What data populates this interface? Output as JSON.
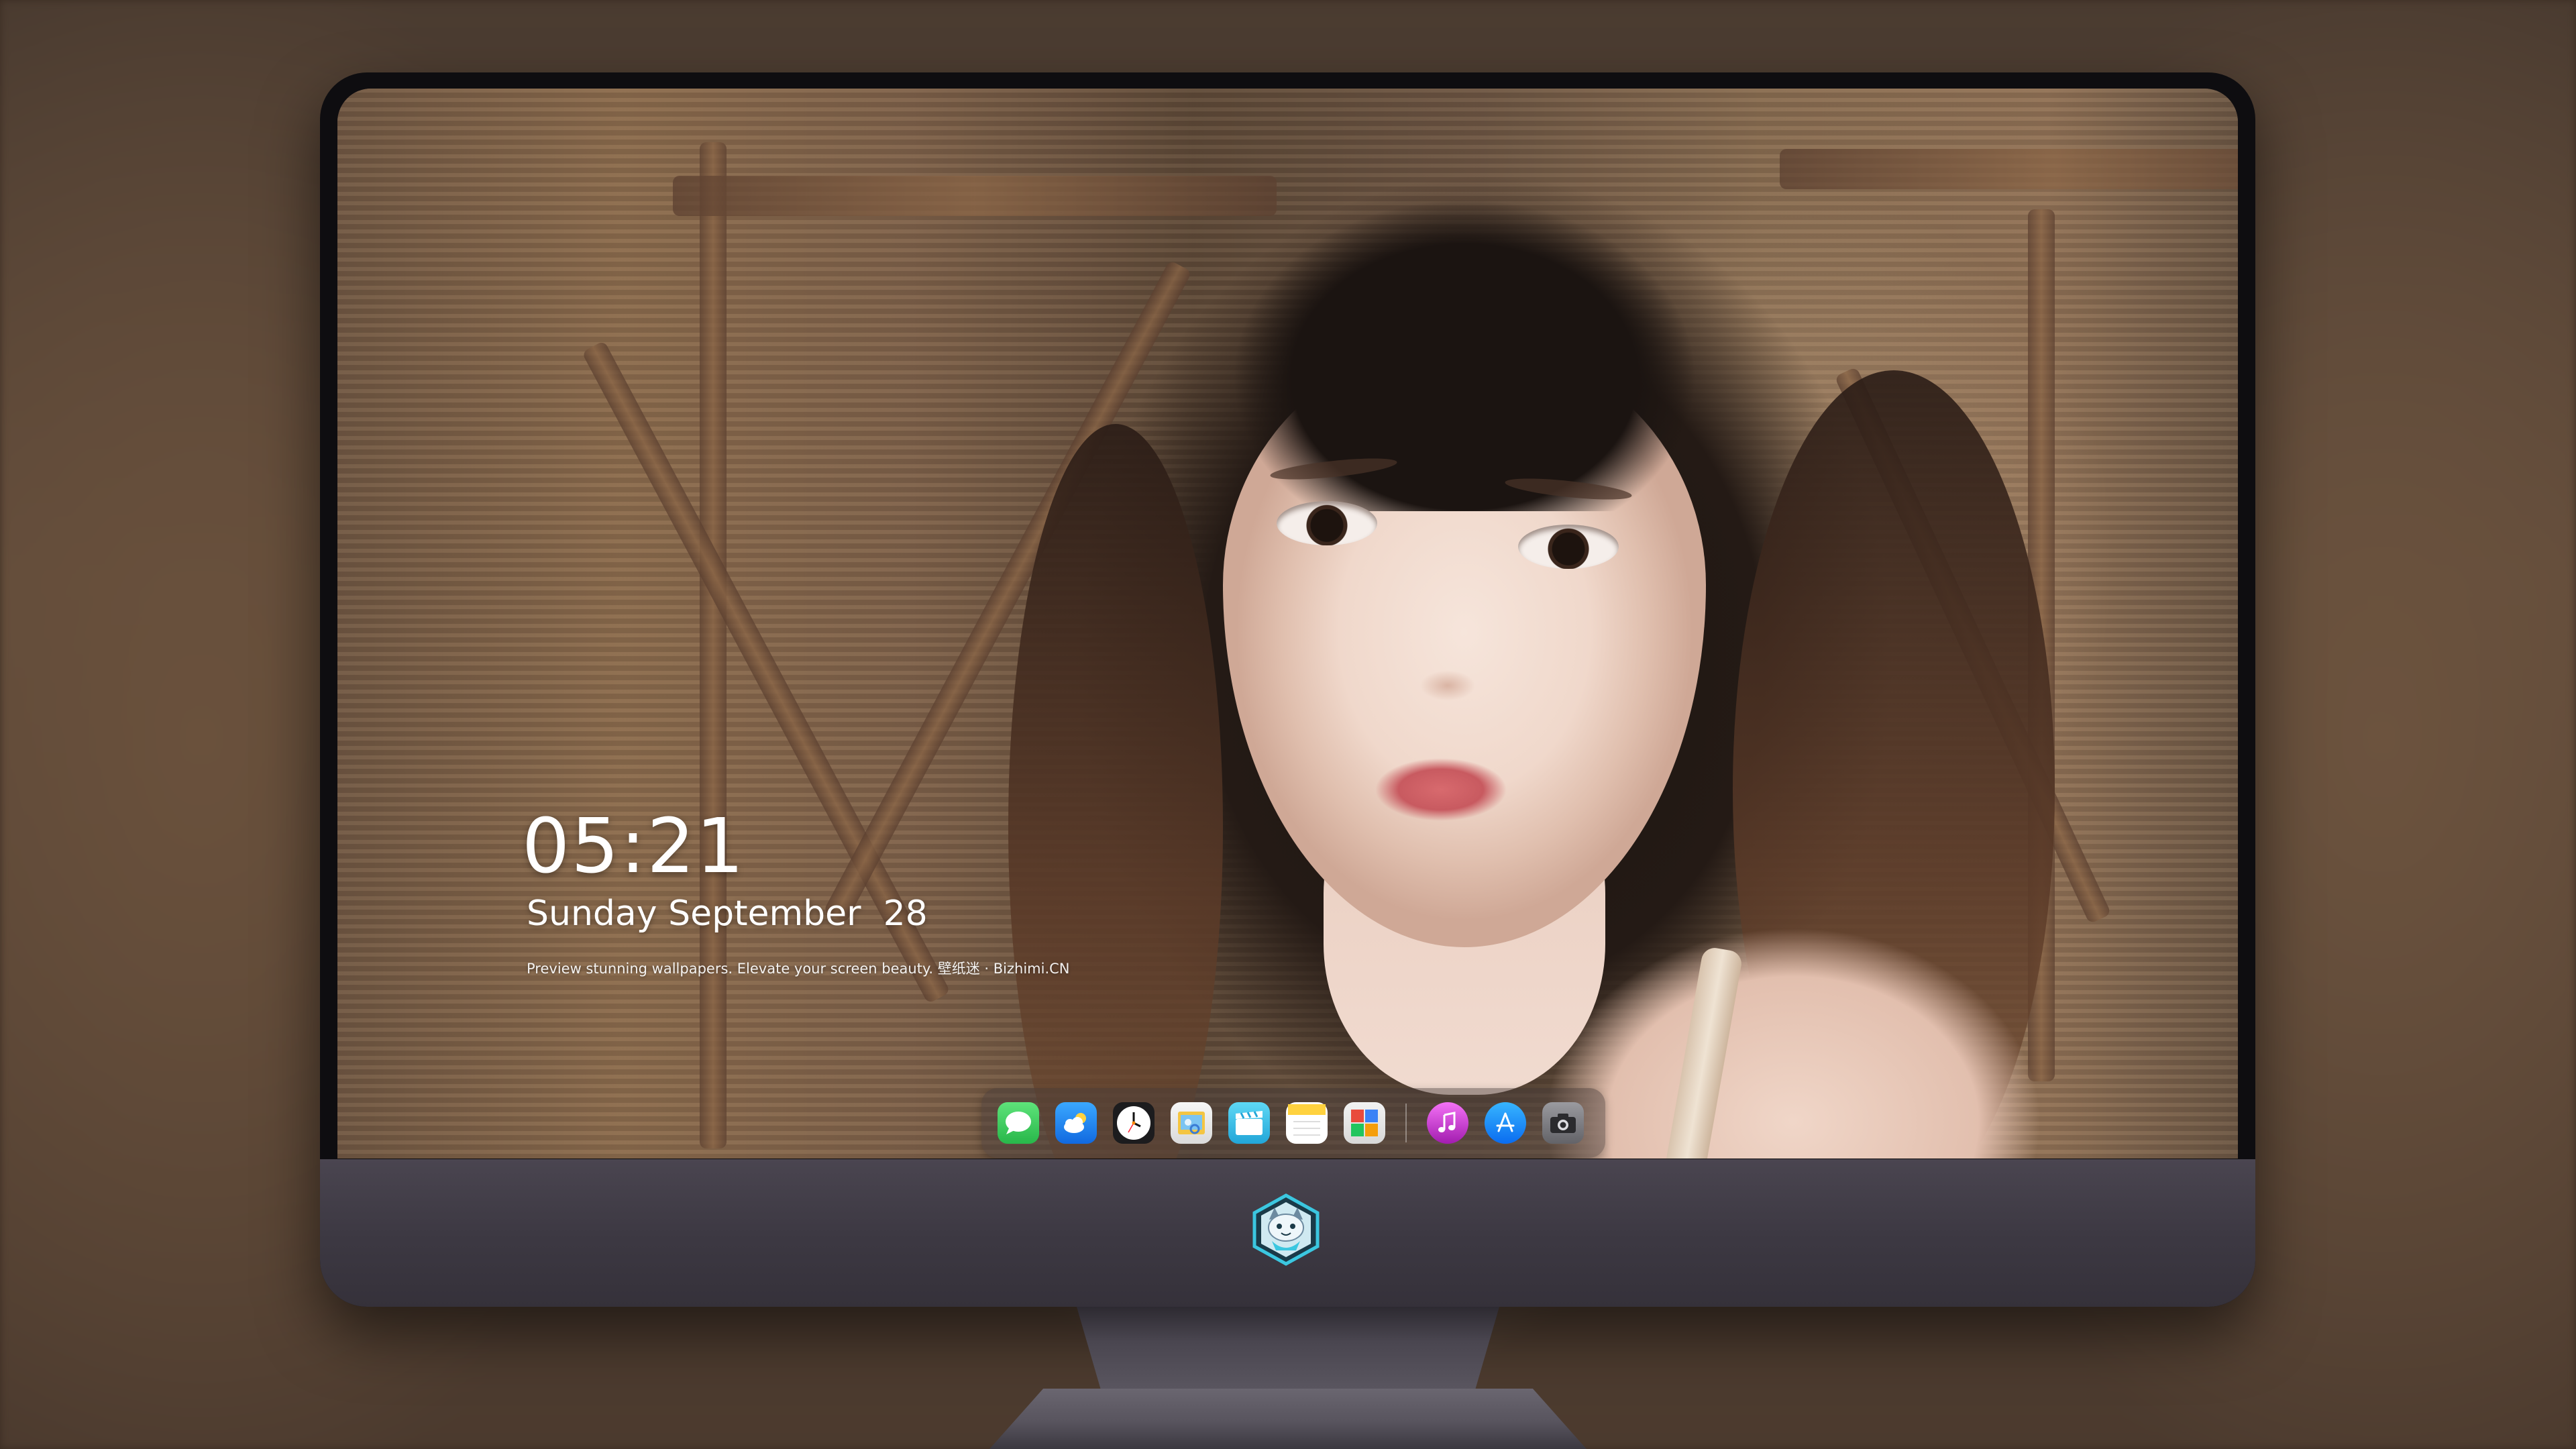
{
  "lockscreen": {
    "time": "05:21",
    "weekday": "Sunday",
    "month": "September",
    "day": "28",
    "tagline": "Preview stunning wallpapers. Elevate your screen beauty. 壁纸迷 · Bizhimi.CN"
  },
  "dock": {
    "apps": [
      {
        "name": "messages",
        "icon": "message-bubble-icon",
        "color": "#34C759"
      },
      {
        "name": "weather",
        "icon": "weather-cloud-icon",
        "color": "#1E90FF"
      },
      {
        "name": "clock",
        "icon": "clock-icon",
        "color": "#FFFFFF"
      },
      {
        "name": "preview",
        "icon": "preview-icon",
        "color": "#F4C542"
      },
      {
        "name": "clips",
        "icon": "clapperboard-icon",
        "color": "#3EC5E8"
      },
      {
        "name": "notes",
        "icon": "notes-icon",
        "color": "#FFD23F"
      },
      {
        "name": "photo-booth",
        "icon": "photo-grid-icon",
        "color": "#E8E8E8"
      },
      {
        "name": "music",
        "icon": "music-note-icon",
        "color": "#D946EF"
      },
      {
        "name": "app-store",
        "icon": "app-store-icon",
        "color": "#1A8CFF"
      },
      {
        "name": "camera",
        "icon": "camera-icon",
        "color": "#8A8A8E"
      }
    ]
  },
  "brand": {
    "logo": "cat-mascot-logo",
    "accent": "#3BC7E0"
  }
}
